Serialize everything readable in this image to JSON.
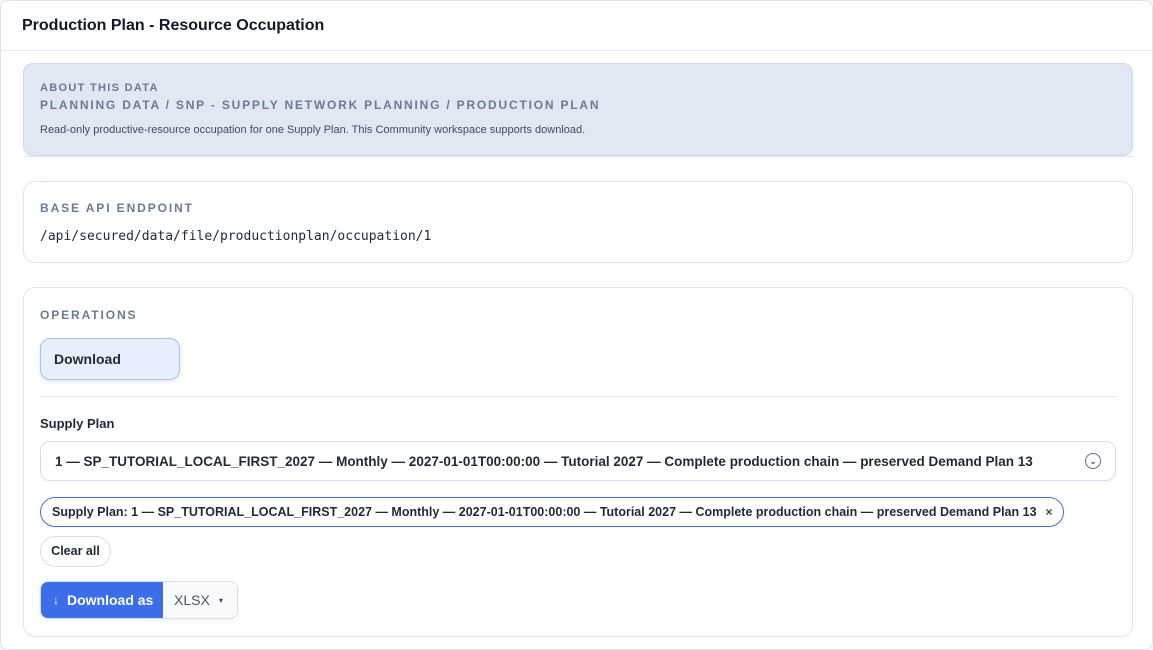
{
  "header": {
    "title": "Production Plan - Resource Occupation"
  },
  "about": {
    "kicker": "ABOUT THIS DATA",
    "path": "PLANNING DATA / SNP - SUPPLY NETWORK PLANNING / PRODUCTION PLAN",
    "description": "Read-only productive-resource occupation for one Supply Plan. This Community workspace supports download."
  },
  "endpoint": {
    "label": "BASE API ENDPOINT",
    "value": "/api/secured/data/file/productionplan/occupation/1"
  },
  "operations": {
    "label": "OPERATIONS",
    "buttons": [
      {
        "label": "Download"
      }
    ],
    "supply_plan": {
      "label": "Supply Plan",
      "selected": "1 — SP_TUTORIAL_LOCAL_FIRST_2027 — Monthly — 2027-01-01T00:00:00 — Tutorial 2027 — Complete production chain — preserved Demand Plan 13"
    },
    "chip": {
      "label": "Supply Plan: 1 — SP_TUTORIAL_LOCAL_FIRST_2027 — Monthly — 2027-01-01T00:00:00 — Tutorial 2027 — Complete production chain — preserved Demand Plan 13",
      "close": "×"
    },
    "clear_all": "Clear all",
    "download": {
      "arrow": "↓",
      "label": "Download as",
      "format": "XLSX",
      "caret": "▾"
    }
  },
  "colors": {
    "accent": "#3b6ee8",
    "about_bg": "#e1e8f3",
    "chip_border": "#4572d6"
  }
}
